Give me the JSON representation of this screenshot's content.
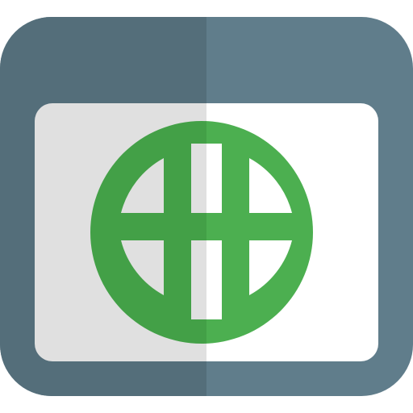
{
  "icon": {
    "name": "browser-globe-icon",
    "colors": {
      "frame": "#607d8b",
      "frame_shadow": "#546e7a",
      "viewport": "#ffffff",
      "viewport_shadow": "#e0e0e0",
      "globe": "#4caf50",
      "globe_shadow": "#43a047"
    }
  }
}
